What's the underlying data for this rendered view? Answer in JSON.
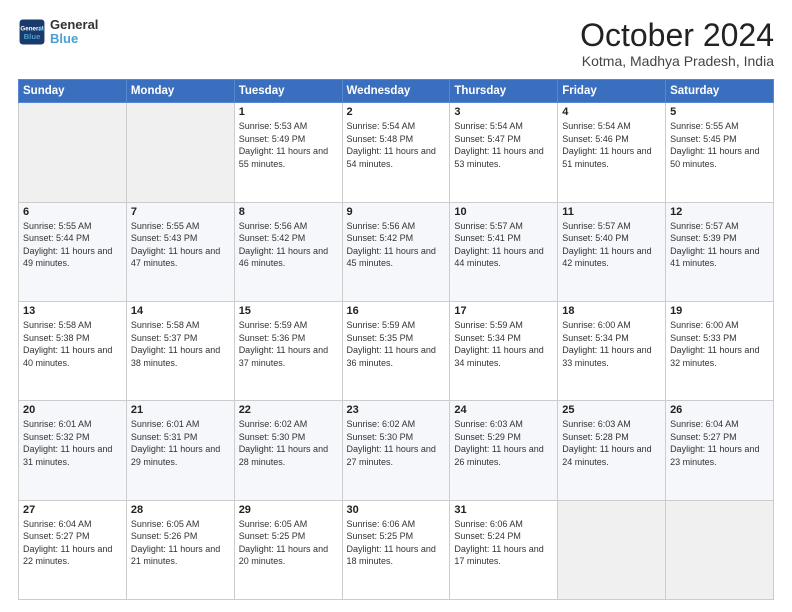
{
  "header": {
    "logo_general": "General",
    "logo_blue": "Blue",
    "month_title": "October 2024",
    "subtitle": "Kotma, Madhya Pradesh, India"
  },
  "days_of_week": [
    "Sunday",
    "Monday",
    "Tuesday",
    "Wednesday",
    "Thursday",
    "Friday",
    "Saturday"
  ],
  "weeks": [
    [
      {
        "day": "",
        "sunrise": "",
        "sunset": "",
        "daylight": ""
      },
      {
        "day": "",
        "sunrise": "",
        "sunset": "",
        "daylight": ""
      },
      {
        "day": "1",
        "sunrise": "Sunrise: 5:53 AM",
        "sunset": "Sunset: 5:49 PM",
        "daylight": "Daylight: 11 hours and 55 minutes."
      },
      {
        "day": "2",
        "sunrise": "Sunrise: 5:54 AM",
        "sunset": "Sunset: 5:48 PM",
        "daylight": "Daylight: 11 hours and 54 minutes."
      },
      {
        "day": "3",
        "sunrise": "Sunrise: 5:54 AM",
        "sunset": "Sunset: 5:47 PM",
        "daylight": "Daylight: 11 hours and 53 minutes."
      },
      {
        "day": "4",
        "sunrise": "Sunrise: 5:54 AM",
        "sunset": "Sunset: 5:46 PM",
        "daylight": "Daylight: 11 hours and 51 minutes."
      },
      {
        "day": "5",
        "sunrise": "Sunrise: 5:55 AM",
        "sunset": "Sunset: 5:45 PM",
        "daylight": "Daylight: 11 hours and 50 minutes."
      }
    ],
    [
      {
        "day": "6",
        "sunrise": "Sunrise: 5:55 AM",
        "sunset": "Sunset: 5:44 PM",
        "daylight": "Daylight: 11 hours and 49 minutes."
      },
      {
        "day": "7",
        "sunrise": "Sunrise: 5:55 AM",
        "sunset": "Sunset: 5:43 PM",
        "daylight": "Daylight: 11 hours and 47 minutes."
      },
      {
        "day": "8",
        "sunrise": "Sunrise: 5:56 AM",
        "sunset": "Sunset: 5:42 PM",
        "daylight": "Daylight: 11 hours and 46 minutes."
      },
      {
        "day": "9",
        "sunrise": "Sunrise: 5:56 AM",
        "sunset": "Sunset: 5:42 PM",
        "daylight": "Daylight: 11 hours and 45 minutes."
      },
      {
        "day": "10",
        "sunrise": "Sunrise: 5:57 AM",
        "sunset": "Sunset: 5:41 PM",
        "daylight": "Daylight: 11 hours and 44 minutes."
      },
      {
        "day": "11",
        "sunrise": "Sunrise: 5:57 AM",
        "sunset": "Sunset: 5:40 PM",
        "daylight": "Daylight: 11 hours and 42 minutes."
      },
      {
        "day": "12",
        "sunrise": "Sunrise: 5:57 AM",
        "sunset": "Sunset: 5:39 PM",
        "daylight": "Daylight: 11 hours and 41 minutes."
      }
    ],
    [
      {
        "day": "13",
        "sunrise": "Sunrise: 5:58 AM",
        "sunset": "Sunset: 5:38 PM",
        "daylight": "Daylight: 11 hours and 40 minutes."
      },
      {
        "day": "14",
        "sunrise": "Sunrise: 5:58 AM",
        "sunset": "Sunset: 5:37 PM",
        "daylight": "Daylight: 11 hours and 38 minutes."
      },
      {
        "day": "15",
        "sunrise": "Sunrise: 5:59 AM",
        "sunset": "Sunset: 5:36 PM",
        "daylight": "Daylight: 11 hours and 37 minutes."
      },
      {
        "day": "16",
        "sunrise": "Sunrise: 5:59 AM",
        "sunset": "Sunset: 5:35 PM",
        "daylight": "Daylight: 11 hours and 36 minutes."
      },
      {
        "day": "17",
        "sunrise": "Sunrise: 5:59 AM",
        "sunset": "Sunset: 5:34 PM",
        "daylight": "Daylight: 11 hours and 34 minutes."
      },
      {
        "day": "18",
        "sunrise": "Sunrise: 6:00 AM",
        "sunset": "Sunset: 5:34 PM",
        "daylight": "Daylight: 11 hours and 33 minutes."
      },
      {
        "day": "19",
        "sunrise": "Sunrise: 6:00 AM",
        "sunset": "Sunset: 5:33 PM",
        "daylight": "Daylight: 11 hours and 32 minutes."
      }
    ],
    [
      {
        "day": "20",
        "sunrise": "Sunrise: 6:01 AM",
        "sunset": "Sunset: 5:32 PM",
        "daylight": "Daylight: 11 hours and 31 minutes."
      },
      {
        "day": "21",
        "sunrise": "Sunrise: 6:01 AM",
        "sunset": "Sunset: 5:31 PM",
        "daylight": "Daylight: 11 hours and 29 minutes."
      },
      {
        "day": "22",
        "sunrise": "Sunrise: 6:02 AM",
        "sunset": "Sunset: 5:30 PM",
        "daylight": "Daylight: 11 hours and 28 minutes."
      },
      {
        "day": "23",
        "sunrise": "Sunrise: 6:02 AM",
        "sunset": "Sunset: 5:30 PM",
        "daylight": "Daylight: 11 hours and 27 minutes."
      },
      {
        "day": "24",
        "sunrise": "Sunrise: 6:03 AM",
        "sunset": "Sunset: 5:29 PM",
        "daylight": "Daylight: 11 hours and 26 minutes."
      },
      {
        "day": "25",
        "sunrise": "Sunrise: 6:03 AM",
        "sunset": "Sunset: 5:28 PM",
        "daylight": "Daylight: 11 hours and 24 minutes."
      },
      {
        "day": "26",
        "sunrise": "Sunrise: 6:04 AM",
        "sunset": "Sunset: 5:27 PM",
        "daylight": "Daylight: 11 hours and 23 minutes."
      }
    ],
    [
      {
        "day": "27",
        "sunrise": "Sunrise: 6:04 AM",
        "sunset": "Sunset: 5:27 PM",
        "daylight": "Daylight: 11 hours and 22 minutes."
      },
      {
        "day": "28",
        "sunrise": "Sunrise: 6:05 AM",
        "sunset": "Sunset: 5:26 PM",
        "daylight": "Daylight: 11 hours and 21 minutes."
      },
      {
        "day": "29",
        "sunrise": "Sunrise: 6:05 AM",
        "sunset": "Sunset: 5:25 PM",
        "daylight": "Daylight: 11 hours and 20 minutes."
      },
      {
        "day": "30",
        "sunrise": "Sunrise: 6:06 AM",
        "sunset": "Sunset: 5:25 PM",
        "daylight": "Daylight: 11 hours and 18 minutes."
      },
      {
        "day": "31",
        "sunrise": "Sunrise: 6:06 AM",
        "sunset": "Sunset: 5:24 PM",
        "daylight": "Daylight: 11 hours and 17 minutes."
      },
      {
        "day": "",
        "sunrise": "",
        "sunset": "",
        "daylight": ""
      },
      {
        "day": "",
        "sunrise": "",
        "sunset": "",
        "daylight": ""
      }
    ]
  ]
}
